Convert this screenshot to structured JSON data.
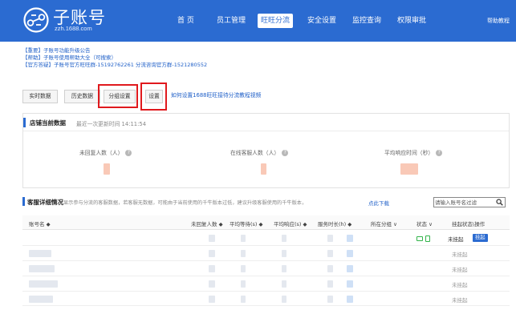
{
  "header": {
    "logo_title": "子账号",
    "logo_sub": "zzh.1688.com",
    "nav": [
      "首 页",
      "员工管理",
      "旺旺分流",
      "安全设置",
      "监控查询",
      "权限审批"
    ],
    "active_nav": "旺旺分流",
    "help": "帮助教程"
  },
  "notices": [
    "【重要】子账号功能升级公告",
    "【帮助】子账号使用帮助大全（可搜索）",
    "【官方答疑】子账号官方旺旺群-15192762261 分流咨询官方群-1521280552"
  ],
  "tabs": [
    "实时数据",
    "历史数据",
    "分组设置",
    "设置"
  ],
  "video_link": "如何设置1688旺旺接待分流教程视频",
  "store_panel": {
    "title": "店铺当前数据",
    "last_update": "最近一次更新时间 14:11:54",
    "stats": [
      "未回复人数（人）",
      "在线客服人数（人）",
      "平均响应时间（秒）"
    ]
  },
  "detail": {
    "title": "客服详细情况",
    "desc": "显示参与分流的客服数据，若客服无数据，可能由于当前使用的千牛版本过低，建议升级客服使用的千牛版本，",
    "download": "点此下载",
    "search_placeholder": "请输入账号名过滤"
  },
  "table": {
    "headers": [
      "账号名 ◆",
      "未回复人数 ◆",
      "平均等待(s) ◆",
      "平均响应(s) ◆",
      "服务时长(h) ◆",
      "所在分组 ∨",
      "状态 ∨",
      "挂起状态\\操作"
    ],
    "rows": [
      {
        "status": "未挂起",
        "action": "挂起"
      },
      {
        "status": "未挂起"
      },
      {
        "status": "未挂起"
      },
      {
        "status": "未挂起"
      },
      {
        "status": "未挂起"
      }
    ]
  },
  "colors": {
    "brand": "#2b6bd1",
    "highlight": "#e0191d",
    "online": "#32b44a"
  },
  "icons": {
    "logo": "link-circle-icon",
    "help": "question-icon",
    "search": "search-icon",
    "status": "monitor-icon"
  }
}
